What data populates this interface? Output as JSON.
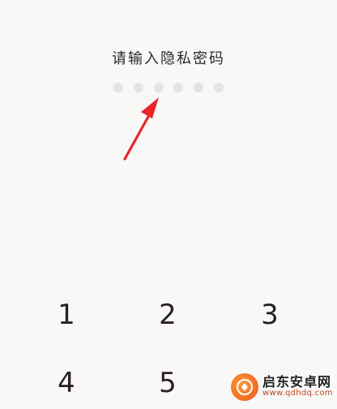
{
  "prompt": "请输入隐私密码",
  "pin": {
    "length": 6,
    "filled": 0
  },
  "keypad": {
    "keys": [
      "1",
      "2",
      "3",
      "4",
      "5"
    ]
  },
  "watermark": {
    "title": "启东安卓网",
    "url": "www.qdhdq.com"
  },
  "colors": {
    "background": "#f8f8f7",
    "dot": "#e3e3e3",
    "arrow": "#e8262a",
    "text": "#2a2a2a"
  }
}
